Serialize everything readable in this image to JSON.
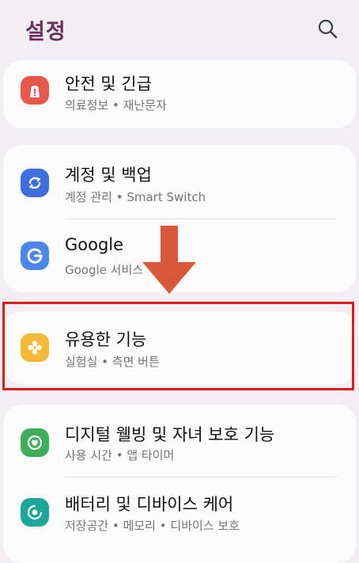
{
  "header": {
    "title": "설정"
  },
  "sections": [
    {
      "items": [
        {
          "title": "안전 및 긴급",
          "subtitle": "의료정보 • 재난문자",
          "icon": "alert-icon",
          "color": "#e8574b"
        }
      ]
    },
    {
      "items": [
        {
          "title": "계정 및 백업",
          "subtitle": "계정 관리 • Smart Switch",
          "icon": "sync-icon",
          "color": "#3f6ee0"
        },
        {
          "title": "Google",
          "subtitle": "Google 서비스",
          "icon": "google-icon",
          "color": "#4a87e8"
        }
      ]
    },
    {
      "items": [
        {
          "title": "유용한 기능",
          "subtitle": "실험실 • 측면 버튼",
          "icon": "puzzle-icon",
          "color": "#f5b935"
        }
      ]
    },
    {
      "items": [
        {
          "title": "디지털 웰빙 및 자녀 보호 기능",
          "subtitle": "사용 시간 • 앱 타이머",
          "icon": "wellbeing-icon",
          "color": "#3fae5a"
        },
        {
          "title": "배터리 및 디바이스 케어",
          "subtitle": "저장공간 • 메모리 • 디바이스 보호",
          "icon": "device-care-icon",
          "color": "#1ca79b"
        }
      ]
    }
  ],
  "annotation": {
    "arrow_color": "#d9583a",
    "box_color": "#e01818"
  }
}
